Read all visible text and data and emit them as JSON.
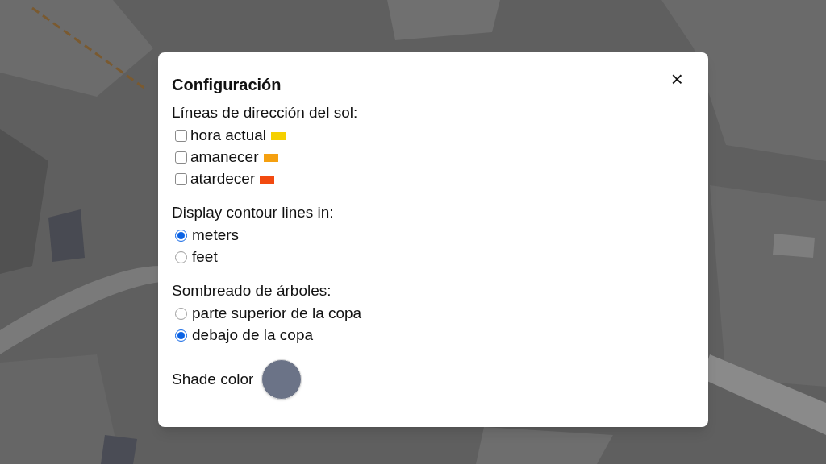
{
  "dialog": {
    "title": "Configuración",
    "close": "×",
    "sections": [
      {
        "kind": "checkbox",
        "label": "Líneas de dirección del sol:",
        "options": [
          {
            "label": "hora actual",
            "checked": false,
            "color": "#f5d000"
          },
          {
            "label": "amanecer",
            "checked": false,
            "color": "#f5a010"
          },
          {
            "label": "atardecer",
            "checked": false,
            "color": "#f24a10"
          }
        ]
      },
      {
        "kind": "radio",
        "label": "Display contour lines in:",
        "options": [
          {
            "label": "meters",
            "selected": true
          },
          {
            "label": "feet",
            "selected": false
          }
        ]
      },
      {
        "kind": "radio",
        "label": "Sombreado de árboles:",
        "options": [
          {
            "label": "parte superior de la copa",
            "selected": false
          },
          {
            "label": "debajo de la copa",
            "selected": true
          }
        ]
      }
    ],
    "shade": {
      "label": "Shade color",
      "color": "#6b7387"
    }
  }
}
